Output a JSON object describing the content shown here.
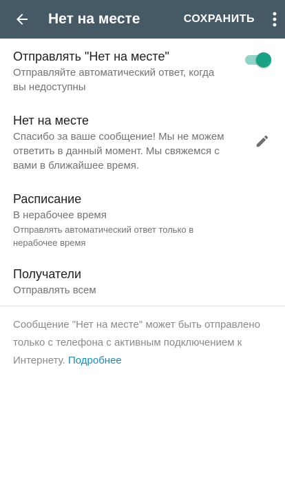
{
  "app_bar": {
    "title": "Нет на месте",
    "save_label": "СОХРАНИТЬ"
  },
  "away_toggle": {
    "title": "Отправлять \"Нет на месте\"",
    "description": "Отправляйте автоматический ответ, когда вы недоступны",
    "enabled": true
  },
  "message": {
    "title": "Нет на месте",
    "text": "Спасибо за ваше сообщение! Мы не можем ответить в данный момент. Мы свяжемся с вами в ближайшее время."
  },
  "schedule": {
    "title": "Расписание",
    "value": "В нерабочее время",
    "hint": "Отправлять автоматический ответ только в нерабочее время"
  },
  "recipients": {
    "title": "Получатели",
    "value": "Отправлять всем"
  },
  "footer": {
    "note": "Сообщение \"Нет на месте\" может быть отправлено только с телефона с активным подключением к Интернету.",
    "link": "Подробнее"
  },
  "colors": {
    "app_bar": "#455a64",
    "accent": "#1aa286",
    "link": "#1b8cb0"
  },
  "icons": [
    "back-arrow-icon",
    "more-vert-icon",
    "pencil-icon"
  ]
}
